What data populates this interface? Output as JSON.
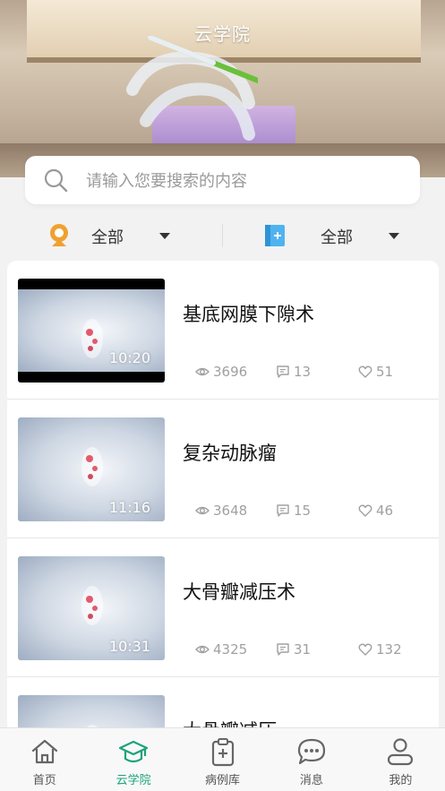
{
  "header": {
    "title": "云学院"
  },
  "search": {
    "placeholder": "请输入您要搜索的内容"
  },
  "filters": [
    {
      "icon": "location-badge-icon",
      "label": "全部"
    },
    {
      "icon": "book-icon",
      "label": "全部"
    }
  ],
  "videos": [
    {
      "title": "基底网膜下隙术",
      "duration": "10:20",
      "views": "3696",
      "comments": "13",
      "likes": "51"
    },
    {
      "title": "复杂动脉瘤",
      "duration": "11:16",
      "views": "3648",
      "comments": "15",
      "likes": "46"
    },
    {
      "title": "大骨瓣减压术",
      "duration": "10:31",
      "views": "4325",
      "comments": "31",
      "likes": "132"
    },
    {
      "title": "大骨瓣减压",
      "duration": "",
      "views": "",
      "comments": "",
      "likes": ""
    }
  ],
  "tabbar": [
    {
      "icon": "home-icon",
      "label": "首页"
    },
    {
      "icon": "graduation-cap-icon",
      "label": "云学院",
      "active": true
    },
    {
      "icon": "medical-clipboard-icon",
      "label": "病例库"
    },
    {
      "icon": "chat-bubble-icon",
      "label": "消息"
    },
    {
      "icon": "user-icon",
      "label": "我的"
    }
  ],
  "colors": {
    "accent": "#1aa37a",
    "filter_icon_1": "#f0a030",
    "filter_icon_2": "#4fb3f0"
  }
}
